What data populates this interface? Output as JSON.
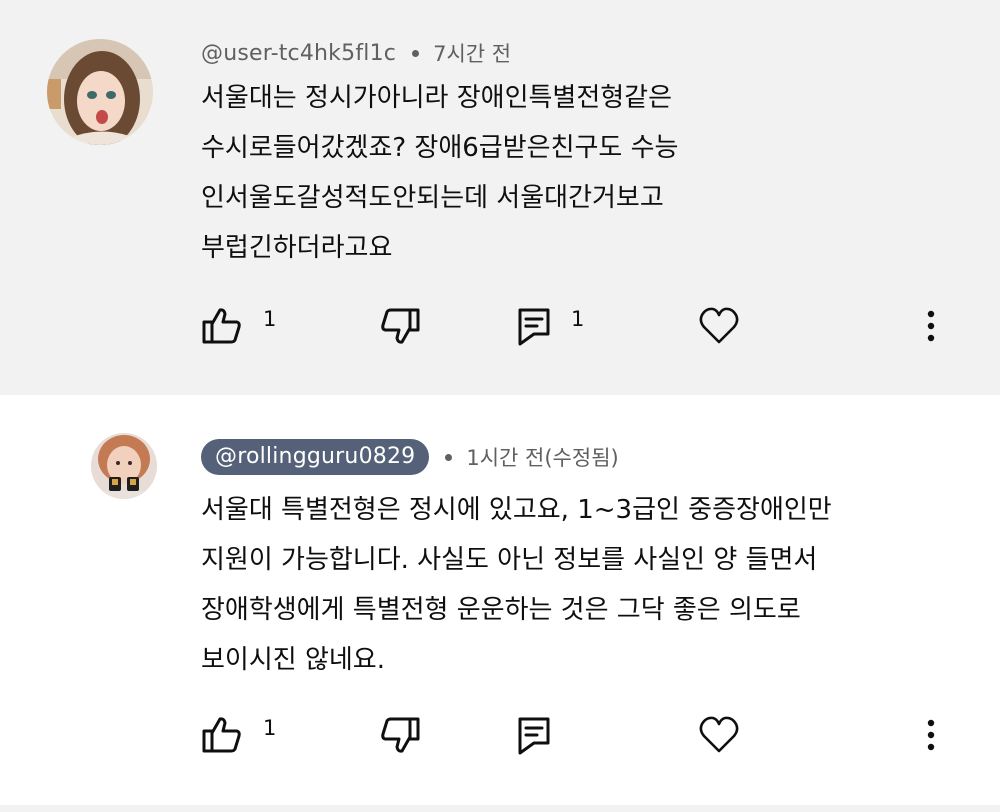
{
  "comments": [
    {
      "handle": "@user-tc4hk5fl1c",
      "time": "7시간 전",
      "lines": [
        "서울대는 정시가아니라 장애인특별전형같은",
        "수시로들어갔겠죠? 장애6급받은친구도 수능",
        "인서울도갈성적도안되는데 서울대간거보고",
        "부럽긴하더라고요"
      ],
      "likes": "1",
      "replies": "1"
    },
    {
      "handle": "@rollingguru0829",
      "time": "1시간 전(수정됨)",
      "lines": [
        "서울대 특별전형은 정시에 있고요, 1~3급인 중증장애인만",
        "지원이 가능합니다. 사실도 아닌 정보를 사실인 양 들면서",
        "장애학생에게 특별전형 운운하는 것은 그닥 좋은 의도로",
        "보이시진 않네요."
      ],
      "likes": "1"
    }
  ],
  "icons": [
    "thumb-up-icon",
    "thumb-down-icon",
    "reply-icon",
    "heart-icon",
    "more-vert-icon"
  ],
  "colors": {
    "highlight_bg": "#f2f2f2",
    "handle_pill": "#546178",
    "text": "#0f0f0f",
    "secondary": "#606060"
  }
}
